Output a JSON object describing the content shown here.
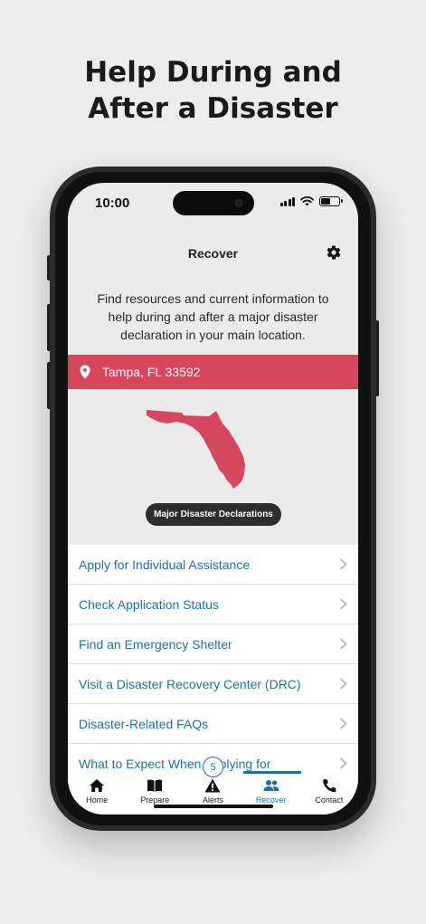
{
  "headline": {
    "line1": "Help During and",
    "line2": "After a Disaster"
  },
  "status_bar": {
    "time": "10:00"
  },
  "header": {
    "title": "Recover",
    "settings_icon": "gear-icon"
  },
  "intro_text": "Find resources and current information to help during and after a major disaster declaration in your main location.",
  "location": {
    "icon": "location-pin-icon",
    "text": "Tampa, FL 33592"
  },
  "map": {
    "region": "Florida",
    "button_label": "Major Disaster Declarations"
  },
  "list_items": [
    {
      "label": "Apply for Individual Assistance"
    },
    {
      "label": "Check Application Status"
    },
    {
      "label": "Find an Emergency Shelter"
    },
    {
      "label": "Visit a Disaster Recovery Center (DRC)"
    },
    {
      "label": "Disaster-Related FAQs"
    },
    {
      "label": "What to Expect When Applying for"
    }
  ],
  "tabs": [
    {
      "label": "Home",
      "icon": "home-icon"
    },
    {
      "label": "Prepare",
      "icon": "book-icon"
    },
    {
      "label": "Alerts",
      "icon": "warning-icon"
    },
    {
      "label": "Recover",
      "icon": "people-icon",
      "active": true
    },
    {
      "label": "Contact",
      "icon": "phone-icon"
    }
  ],
  "alerts_badge": "5",
  "colors": {
    "accent": "#1a73a8",
    "location_bar": "#d6475e",
    "map_fill": "#d6475e"
  }
}
